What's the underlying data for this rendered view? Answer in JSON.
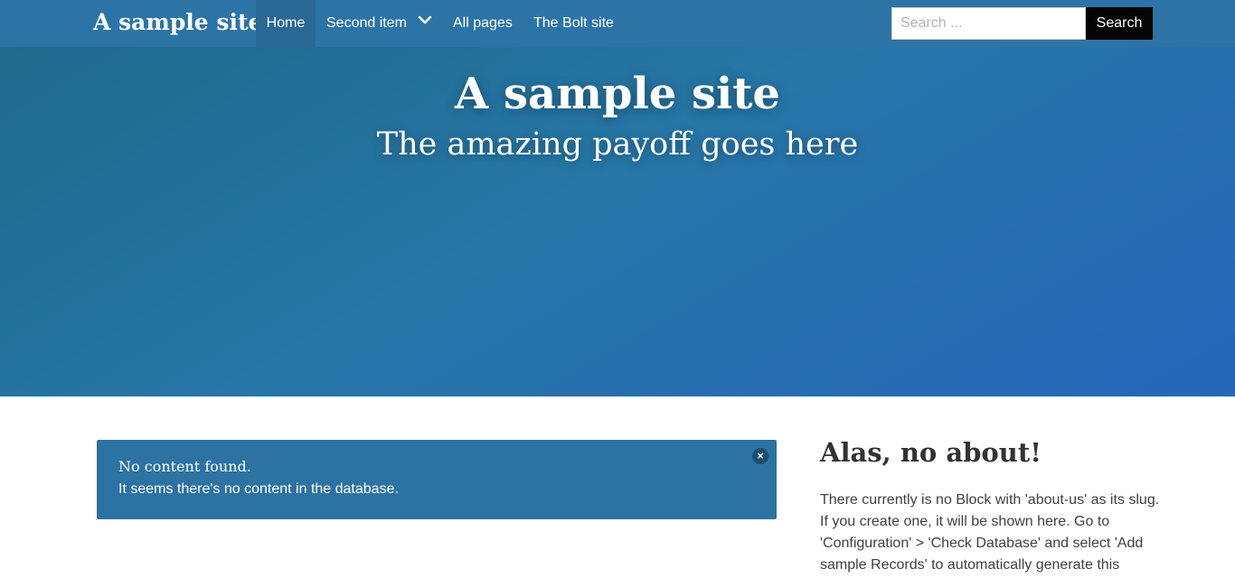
{
  "navbar": {
    "brand": "A sample site",
    "items": [
      {
        "label": "Home",
        "active": true
      },
      {
        "label": "Second item",
        "has_dropdown": true,
        "icon": "chevron-down-icon"
      },
      {
        "label": "All pages"
      },
      {
        "label": "The Bolt site"
      }
    ],
    "search": {
      "placeholder": "Search ...",
      "value": "",
      "button_label": "Search"
    },
    "background_color": "#2c74a5"
  },
  "hero": {
    "title": "A sample site",
    "subtitle": "The amazing payoff goes here"
  },
  "alert": {
    "title": "No content found.",
    "text": "It seems there's no content in the database.",
    "close_icon": "close-icon",
    "background_color": "#2c73a3"
  },
  "about": {
    "title": "Alas, no about!",
    "text": "There currently is no Block with 'about-us' as its slug. If you create one, it will be shown here. Go to 'Configuration' > 'Check Database' and select 'Add sample Records' to automatically generate this"
  }
}
